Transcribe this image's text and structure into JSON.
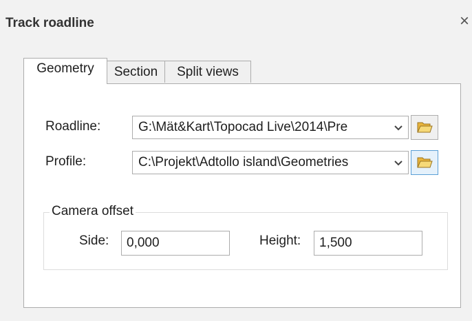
{
  "window": {
    "title": "Track roadline",
    "close_symbol": "×"
  },
  "tabs": [
    {
      "label": "Geometry",
      "active": true
    },
    {
      "label": "Section",
      "active": false
    },
    {
      "label": "Split views",
      "active": false
    }
  ],
  "geometry": {
    "roadline": {
      "label": "Roadline:",
      "value": "G:\\Mät&Kart\\Topocad Live\\2014\\Pre"
    },
    "profile": {
      "label": "Profile:",
      "value": "C:\\Projekt\\Adtollo island\\Geometries"
    },
    "camera_offset": {
      "legend": "Camera offset",
      "side_label": "Side:",
      "side_value": "0,000",
      "height_label": "Height:",
      "height_value": "1,500"
    }
  },
  "icons": {
    "close": "close-icon",
    "dropdown": "chevron-down-icon",
    "browse": "folder-open-icon"
  },
  "colors": {
    "window_bg": "#f2f2f2",
    "panel_bg": "#ffffff",
    "border": "#acacac",
    "hot_button_border": "#5a9fd6",
    "folder_yellow": "#f1c75a"
  }
}
